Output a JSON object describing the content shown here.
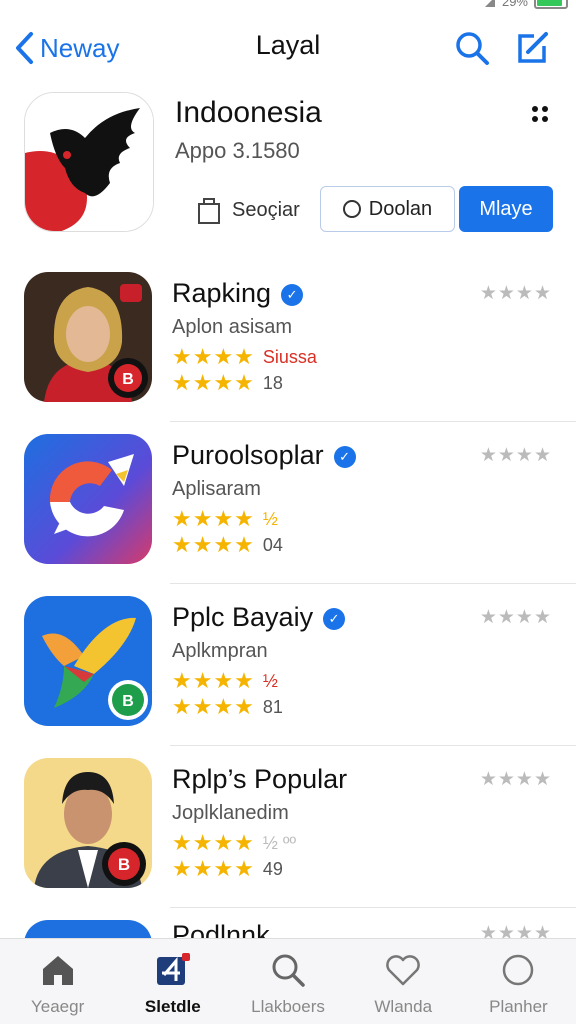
{
  "status": {
    "battery_text": "29%",
    "battery_level": 0.9,
    "battery_color": "#34c759"
  },
  "nav": {
    "back_label": "Neway",
    "title": "Layal",
    "icons": [
      "search-icon",
      "compose-icon"
    ]
  },
  "featured": {
    "title": "Indoonesia",
    "subtitle": "Appo 3.1580",
    "save_label": "Seoçiar",
    "download_label": "Doolan",
    "get_label": "Mlaye"
  },
  "apps": [
    {
      "name": "Rapking",
      "category": "Aplon asisam",
      "stars1": "★★★★",
      "stars1_text": "Siussa",
      "stars2": "★★★★",
      "stars2_text": "18",
      "rating_placeholder": "★★★★"
    },
    {
      "name": "Puroolsoplar",
      "category": "Aplisaram",
      "stars1": "★★★★",
      "stars1_text": "½",
      "stars2": "★★★★",
      "stars2_text": "04",
      "rating_placeholder": "★★★★"
    },
    {
      "name": "Pplc Bayaiy",
      "category": "Aplkmpran",
      "stars1": "★★★★",
      "stars1_text": "½",
      "stars2": "★★★★",
      "stars2_text": "81",
      "rating_placeholder": "★★★★"
    },
    {
      "name": "Rplp’s Popular",
      "category": "Joplklanedim",
      "stars1": "★★★★",
      "stars1_text": "½ ºº",
      "stars2": "★★★★",
      "stars2_text": "49",
      "rating_placeholder": "★★★★"
    },
    {
      "name": "Podlnnk",
      "category": "",
      "stars1": "",
      "stars1_text": "",
      "stars2": "",
      "stars2_text": "",
      "rating_placeholder": "★★★★"
    }
  ],
  "tabs": [
    {
      "label": "Yeaegr",
      "icon": "home-icon"
    },
    {
      "label": "Sletdle",
      "icon": "apps-icon"
    },
    {
      "label": "Llakboers",
      "icon": "search-icon"
    },
    {
      "label": "Wlanda",
      "icon": "heart-icon"
    },
    {
      "label": "Planher",
      "icon": "circle-icon"
    }
  ],
  "colors": {
    "accent": "#1a73e8",
    "star": "#f5b400"
  }
}
